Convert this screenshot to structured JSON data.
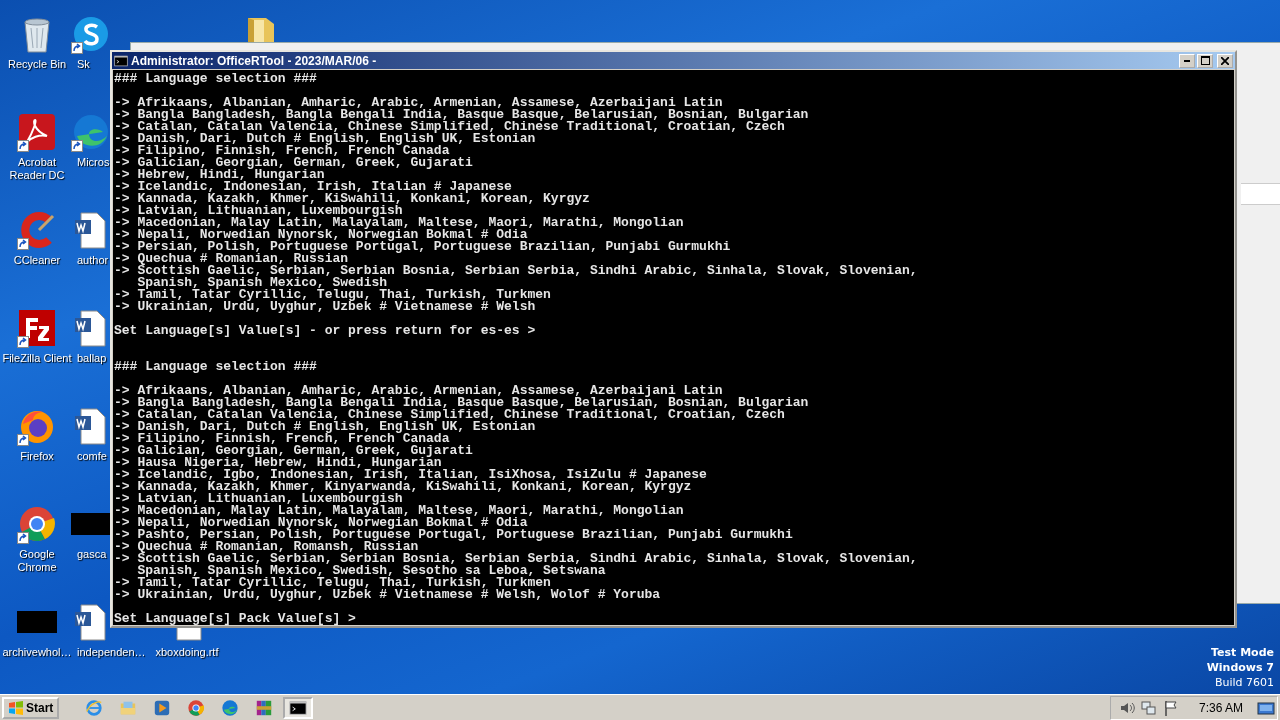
{
  "desktop": {
    "columns": [
      {
        "icons": [
          {
            "label": "Recycle Bin",
            "kind": "recycle",
            "shortcut": false
          },
          {
            "label": "Acrobat Reader DC",
            "kind": "acrobat",
            "shortcut": true
          },
          {
            "label": "CCleaner",
            "kind": "ccleaner",
            "shortcut": true
          },
          {
            "label": "FileZilla Client",
            "kind": "filezilla",
            "shortcut": true
          },
          {
            "label": "Firefox",
            "kind": "firefox",
            "shortcut": true
          },
          {
            "label": "Google Chrome",
            "kind": "chrome",
            "shortcut": true
          },
          {
            "label": "archivewhol…",
            "kind": "black",
            "shortcut": false
          }
        ]
      },
      {
        "icons": [
          {
            "label": "Sk",
            "kind": "skype",
            "shortcut": true
          },
          {
            "label": "Micros",
            "kind": "edge",
            "shortcut": true
          },
          {
            "label": "author",
            "kind": "word",
            "shortcut": false
          },
          {
            "label": "ballap",
            "kind": "word",
            "shortcut": false
          },
          {
            "label": "comfe",
            "kind": "word",
            "shortcut": false
          },
          {
            "label": "gasca",
            "kind": "black",
            "shortcut": false
          },
          {
            "label": "independen…",
            "kind": "word",
            "shortcut": false
          }
        ]
      },
      {
        "icons": [
          {
            "label": "xboxdoing.rtf",
            "kind": "word",
            "shortcut": false
          }
        ]
      },
      {
        "icons": [
          {
            "kind": "folder"
          }
        ]
      }
    ]
  },
  "console": {
    "title": "Administrator: OfficeRTool - 2023/MAR/06 -",
    "sections": [
      {
        "heading": "### Language selection ###",
        "lines": [
          "-> Afrikaans, Albanian, Amharic, Arabic, Armenian, Assamese, Azerbaijani Latin",
          "-> Bangla Bangladesh, Bangla Bengali India, Basque Basque, Belarusian, Bosnian, Bulgarian",
          "-> Catalan, Catalan Valencia, Chinese Simplified, Chinese Traditional, Croatian, Czech",
          "-> Danish, Dari, Dutch # English, English UK, Estonian",
          "-> Filipino, Finnish, French, French Canada",
          "-> Galician, Georgian, German, Greek, Gujarati",
          "-> Hebrew, Hindi, Hungarian",
          "-> Icelandic, Indonesian, Irish, Italian # Japanese",
          "-> Kannada, Kazakh, Khmer, KiSwahili, Konkani, Korean, Kyrgyz",
          "-> Latvian, Lithuanian, Luxembourgish",
          "-> Macedonian, Malay Latin, Malayalam, Maltese, Maori, Marathi, Mongolian",
          "-> Nepali, Norwedian Nynorsk, Norwegian Bokmal # Odia",
          "-> Persian, Polish, Portuguese Portugal, Portuguese Brazilian, Punjabi Gurmukhi",
          "-> Quechua # Romanian, Russian",
          "-> Scottish Gaelic, Serbian, Serbian Bosnia, Serbian Serbia, Sindhi Arabic, Sinhala, Slovak, Slovenian,",
          "   Spanish, Spanish Mexico, Swedish",
          "-> Tamil, Tatar Cyrillic, Telugu, Thai, Turkish, Turkmen",
          "-> Ukrainian, Urdu, Uyghur, Uzbek # Vietnamese # Welsh"
        ],
        "prompt": "Set Language[s] Value[s] - or press return for es-es >"
      },
      {
        "heading": "### Language selection ###",
        "lines": [
          "-> Afrikaans, Albanian, Amharic, Arabic, Armenian, Assamese, Azerbaijani Latin",
          "-> Bangla Bangladesh, Bangla Bengali India, Basque Basque, Belarusian, Bosnian, Bulgarian",
          "-> Catalan, Catalan Valencia, Chinese Simplified, Chinese Traditional, Croatian, Czech",
          "-> Danish, Dari, Dutch # English, English UK, Estonian",
          "-> Filipino, Finnish, French, French Canada",
          "-> Galician, Georgian, German, Greek, Gujarati",
          "-> Hausa Nigeria, Hebrew, Hindi, Hungarian",
          "-> Icelandic, Igbo, Indonesian, Irish, Italian, IsiXhosa, IsiZulu # Japanese",
          "-> Kannada, Kazakh, Khmer, Kinyarwanda, KiSwahili, Konkani, Korean, Kyrgyz",
          "-> Latvian, Lithuanian, Luxembourgish",
          "-> Macedonian, Malay Latin, Malayalam, Maltese, Maori, Marathi, Mongolian",
          "-> Nepali, Norwedian Nynorsk, Norwegian Bokmal # Odia",
          "-> Pashto, Persian, Polish, Portuguese Portugal, Portuguese Brazilian, Punjabi Gurmukhi",
          "-> Quechua # Romanian, Romansh, Russian",
          "-> Scottish Gaelic, Serbian, Serbian Bosnia, Serbian Serbia, Sindhi Arabic, Sinhala, Slovak, Slovenian,",
          "   Spanish, Spanish Mexico, Swedish, Sesotho sa Leboa, Setswana",
          "-> Tamil, Tatar Cyrillic, Telugu, Thai, Turkish, Turkmen",
          "-> Ukrainian, Urdu, Uyghur, Uzbek # Vietnamese # Welsh, Wolof # Yoruba"
        ],
        "prompt": "Set Language[s] Pack Value[s] >"
      }
    ]
  },
  "os_notice": [
    "Test Mode",
    "Windows 7",
    "Build 7601"
  ],
  "taskbar": {
    "start": "Start",
    "apps": [
      {
        "kind": "ie",
        "selected": false
      },
      {
        "kind": "explorer",
        "selected": false
      },
      {
        "kind": "media",
        "selected": false
      },
      {
        "kind": "chrome",
        "selected": false
      },
      {
        "kind": "edge",
        "selected": false
      },
      {
        "kind": "winrar",
        "selected": false
      },
      {
        "kind": "cmd",
        "selected": true
      }
    ],
    "clock": "7:36 AM"
  }
}
